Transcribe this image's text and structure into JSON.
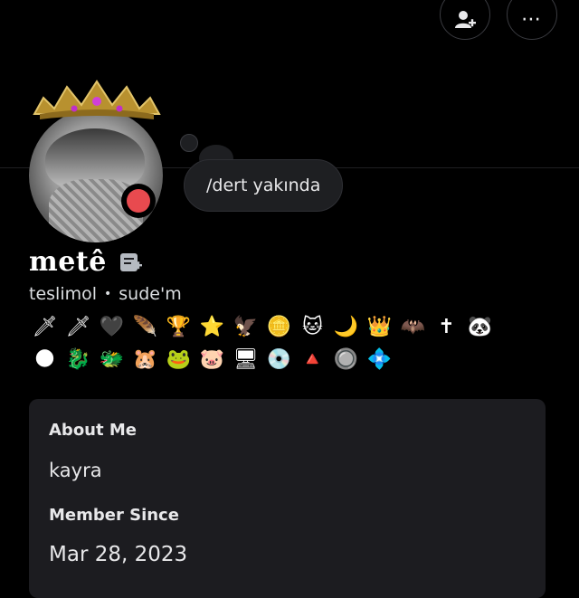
{
  "header": {
    "add_friend_icon": "add-friend-icon",
    "more_label": "⋯"
  },
  "avatar": {
    "decoration": "crown-decoration",
    "status": "do-not-disturb",
    "status_color": "#e84a4f"
  },
  "custom_status": {
    "text": "/dert yakında"
  },
  "profile": {
    "display_name": "metê",
    "username": "teslimol",
    "separator": "•",
    "pronouns": "sude'm"
  },
  "badges": {
    "row1": [
      "🗡",
      "🗡",
      "🖤",
      "🪶",
      "🏆",
      "⭐",
      "🦅",
      "🪙",
      "🐱",
      "🌙",
      "👑",
      "🦇",
      "✝",
      "🐼"
    ],
    "row2": [
      "🌑",
      "🐉",
      "🐲",
      "🐹",
      "🐸",
      "🐷",
      "🖥",
      "💿",
      "🔺",
      "🔘",
      "💠"
    ]
  },
  "about": {
    "about_heading": "About Me",
    "about_text": "kayra",
    "member_heading": "Member Since",
    "member_date": "Mar 28, 2023"
  }
}
